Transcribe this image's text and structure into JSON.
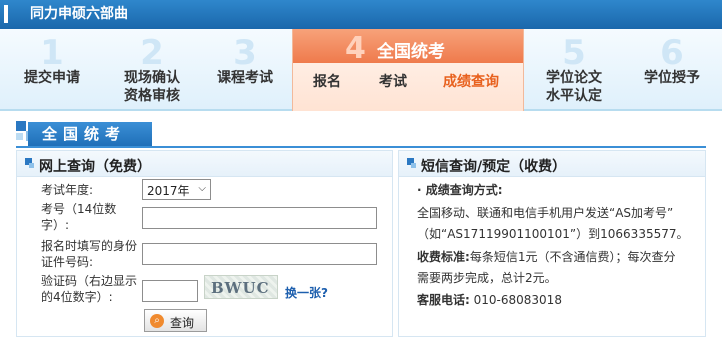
{
  "header": {
    "title": "同力申硕六部曲"
  },
  "steps": [
    {
      "num": "1",
      "label": "提交申请"
    },
    {
      "num": "2",
      "label": "现场确认",
      "label2": "资格审核"
    },
    {
      "num": "3",
      "label": "课程考试"
    },
    {
      "num": "4",
      "label": "全国统考",
      "subs": [
        "报名",
        "考试",
        "成绩查询"
      ]
    },
    {
      "num": "5",
      "label": "学位论文",
      "label2": "水平认定"
    },
    {
      "num": "6",
      "label": "学位授予"
    }
  ],
  "section": {
    "title": "全国统考"
  },
  "online": {
    "heading": "网上查询（免费）",
    "year_label": "考试年度:",
    "year_value": "2017年",
    "exam_no_label_1": "考号（14位数",
    "exam_no_label_2": "字）:",
    "id_label_1": "报名时填写的身份",
    "id_label_2": "证件号码:",
    "captcha_label_1": "验证码（右边显示",
    "captcha_label_2": "的4位数字）:",
    "captcha_text": "BWUC",
    "change_link": "换一张?",
    "query_button": "查询",
    "query_icon": "search-icon"
  },
  "sms": {
    "heading": "短信查询/预定（收费）",
    "method_title": "· 成绩查询方式:",
    "line1": "全国移动、联通和电信手机用户发送“AS加考号”",
    "line2": "（如“AS17119901100101”）到1066335577。",
    "fee_label": "收费标准:",
    "fee_text": "每条短信1元（不含通信费）；每次查分",
    "fee_text2": "需要两步完成，总计2元。",
    "service_label": "客服电话:",
    "service_phone": "010-68083018"
  },
  "colors": {
    "brand_blue": "#1f6fb8",
    "accent_orange": "#e8611e"
  }
}
